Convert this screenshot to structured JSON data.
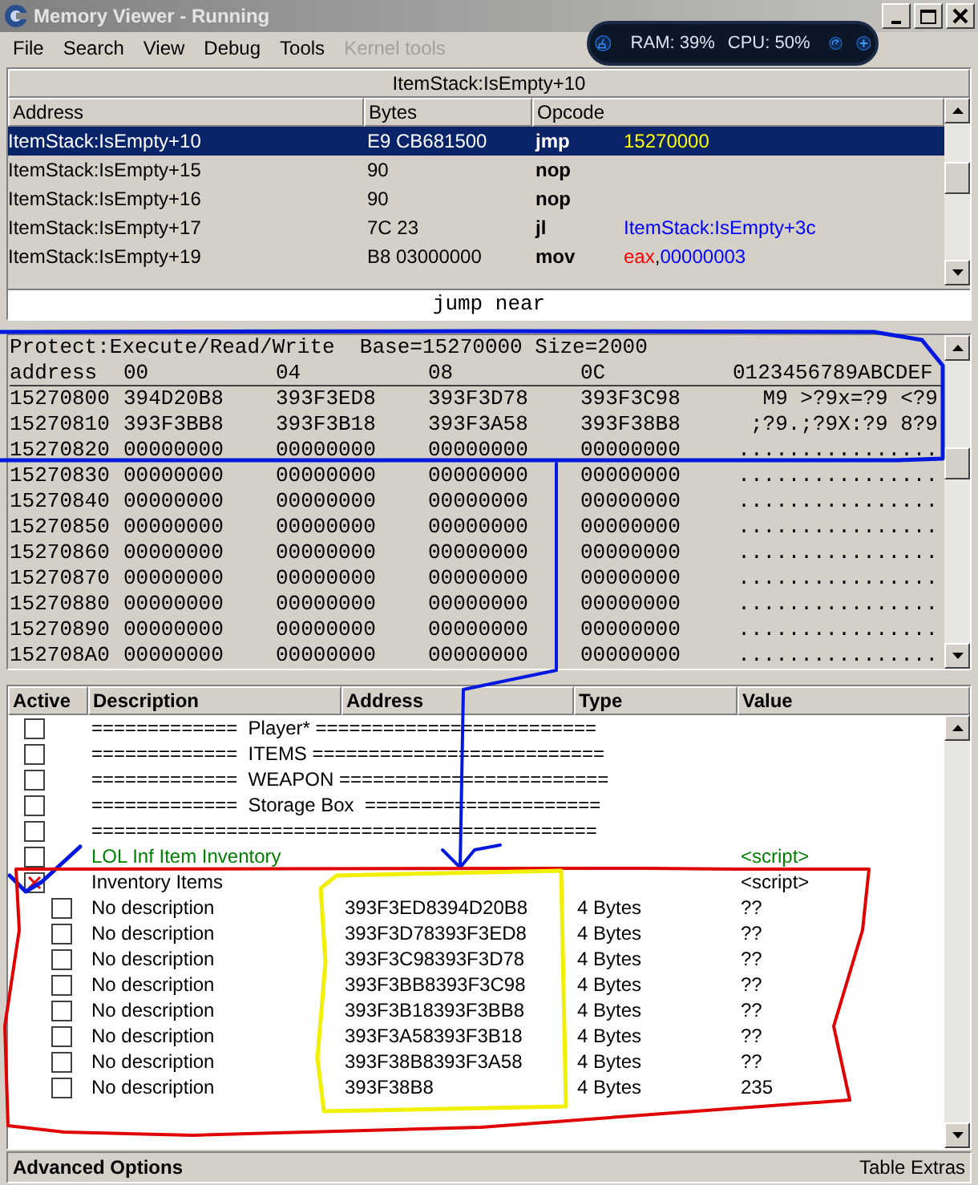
{
  "window": {
    "title": "Memory Viewer - Running"
  },
  "menu": [
    {
      "label": "File",
      "disabled": false
    },
    {
      "label": "Search",
      "disabled": false
    },
    {
      "label": "View",
      "disabled": false
    },
    {
      "label": "Debug",
      "disabled": false
    },
    {
      "label": "Tools",
      "disabled": false
    },
    {
      "label": "Kernel tools",
      "disabled": true
    }
  ],
  "monitor": {
    "ram": "RAM: 39%",
    "cpu": "CPU: 50%"
  },
  "disassembler": {
    "location": "ItemStack:IsEmpty+10",
    "columns": [
      "Address",
      "Bytes",
      "Opcode"
    ],
    "rows": [
      {
        "address": "ItemStack:IsEmpty+10",
        "bytes": "E9 CB681500",
        "mnemonic": "jmp",
        "operands": [
          {
            "text": "15270000",
            "kind": "number"
          }
        ],
        "selected": true
      },
      {
        "address": "ItemStack:IsEmpty+15",
        "bytes": "90",
        "mnemonic": "nop",
        "operands": [],
        "selected": false
      },
      {
        "address": "ItemStack:IsEmpty+16",
        "bytes": "90",
        "mnemonic": "nop",
        "operands": [],
        "selected": false
      },
      {
        "address": "ItemStack:IsEmpty+17",
        "bytes": "7C 23",
        "mnemonic": "jl",
        "operands": [
          {
            "text": "ItemStack:IsEmpty+3c",
            "kind": "symbol"
          }
        ],
        "selected": false
      },
      {
        "address": "ItemStack:IsEmpty+19",
        "bytes": "B8 03000000",
        "mnemonic": "mov",
        "operands": [
          {
            "text": "eax",
            "kind": "register"
          },
          {
            "text": ",",
            "kind": "plain"
          },
          {
            "text": "00000003",
            "kind": "number"
          }
        ],
        "selected": false
      }
    ],
    "description": "jump near"
  },
  "hex_view": {
    "info": "Protect:Execute/Read/Write  Base=15270000 Size=2000",
    "columns": [
      "address",
      "00",
      "04",
      "08",
      "0C",
      "0123456789ABCDEF"
    ],
    "rows": [
      {
        "cells": [
          "15270800",
          "394D20B8",
          "393F3ED8",
          "393F3D78",
          "393F3C98",
          " M9 >?9x=?9 <?9"
        ]
      },
      {
        "cells": [
          "15270810",
          "393F3BB8",
          "393F3B18",
          "393F3A58",
          "393F38B8",
          ";?9.;?9X:?9 8?9"
        ]
      },
      {
        "cells": [
          "15270820",
          "00000000",
          "00000000",
          "00000000",
          "00000000",
          "................"
        ]
      },
      {
        "cells": [
          "15270830",
          "00000000",
          "00000000",
          "00000000",
          "00000000",
          "................"
        ]
      },
      {
        "cells": [
          "15270840",
          "00000000",
          "00000000",
          "00000000",
          "00000000",
          "................"
        ]
      },
      {
        "cells": [
          "15270850",
          "00000000",
          "00000000",
          "00000000",
          "00000000",
          "................"
        ]
      },
      {
        "cells": [
          "15270860",
          "00000000",
          "00000000",
          "00000000",
          "00000000",
          "................"
        ]
      },
      {
        "cells": [
          "15270870",
          "00000000",
          "00000000",
          "00000000",
          "00000000",
          "................"
        ]
      },
      {
        "cells": [
          "15270880",
          "00000000",
          "00000000",
          "00000000",
          "00000000",
          "................"
        ]
      },
      {
        "cells": [
          "15270890",
          "00000000",
          "00000000",
          "00000000",
          "00000000",
          "................"
        ]
      },
      {
        "cells": [
          "152708A0",
          "00000000",
          "00000000",
          "00000000",
          "00000000",
          "................"
        ]
      }
    ]
  },
  "cheat_table": {
    "columns": [
      "Active",
      "Description",
      "Address",
      "Type",
      "Value"
    ],
    "rows": [
      {
        "description": "=============  Player* =========================",
        "checked": false,
        "color": "#000000"
      },
      {
        "description": "=============  ITEMS ==========================",
        "checked": false,
        "color": "#000000"
      },
      {
        "description": "=============  WEAPON ========================",
        "checked": false,
        "color": "#000000"
      },
      {
        "description": "=============  Storage Box  =====================",
        "checked": false,
        "color": "#000000"
      },
      {
        "description": "=============================================",
        "checked": false,
        "color": "#000000"
      },
      {
        "description": "LOL Inf Item Inventory",
        "checked": false,
        "color": "#008000",
        "value": "<script>"
      },
      {
        "description": "Inventory Items",
        "checked": true,
        "color": "#000000",
        "value": "<script>",
        "children": [
          {
            "description": "No description",
            "checked": false,
            "color": "#000000",
            "address": "393F3ED8394D20B8",
            "type": "4 Bytes",
            "value": "??"
          },
          {
            "description": "No description",
            "checked": false,
            "color": "#000000",
            "address": "393F3D78393F3ED8",
            "type": "4 Bytes",
            "value": "??"
          },
          {
            "description": "No description",
            "checked": false,
            "color": "#000000",
            "address": "393F3C98393F3D78",
            "type": "4 Bytes",
            "value": "??"
          },
          {
            "description": "No description",
            "checked": false,
            "color": "#000000",
            "address": "393F3BB8393F3C98",
            "type": "4 Bytes",
            "value": "??"
          },
          {
            "description": "No description",
            "checked": false,
            "color": "#000000",
            "address": "393F3B18393F3BB8",
            "type": "4 Bytes",
            "value": "??"
          },
          {
            "description": "No description",
            "checked": false,
            "color": "#000000",
            "address": "393F3A58393F3B18",
            "type": "4 Bytes",
            "value": "??"
          },
          {
            "description": "No description",
            "checked": false,
            "color": "#000000",
            "address": "393F38B8393F3A58",
            "type": "4 Bytes",
            "value": "??"
          },
          {
            "description": "No description",
            "checked": false,
            "color": "#000000",
            "address": "393F38B8",
            "type": "4 Bytes",
            "value": "235"
          }
        ]
      }
    ]
  },
  "status_bar": {
    "left": "Advanced Options",
    "right": "Table Extras"
  }
}
